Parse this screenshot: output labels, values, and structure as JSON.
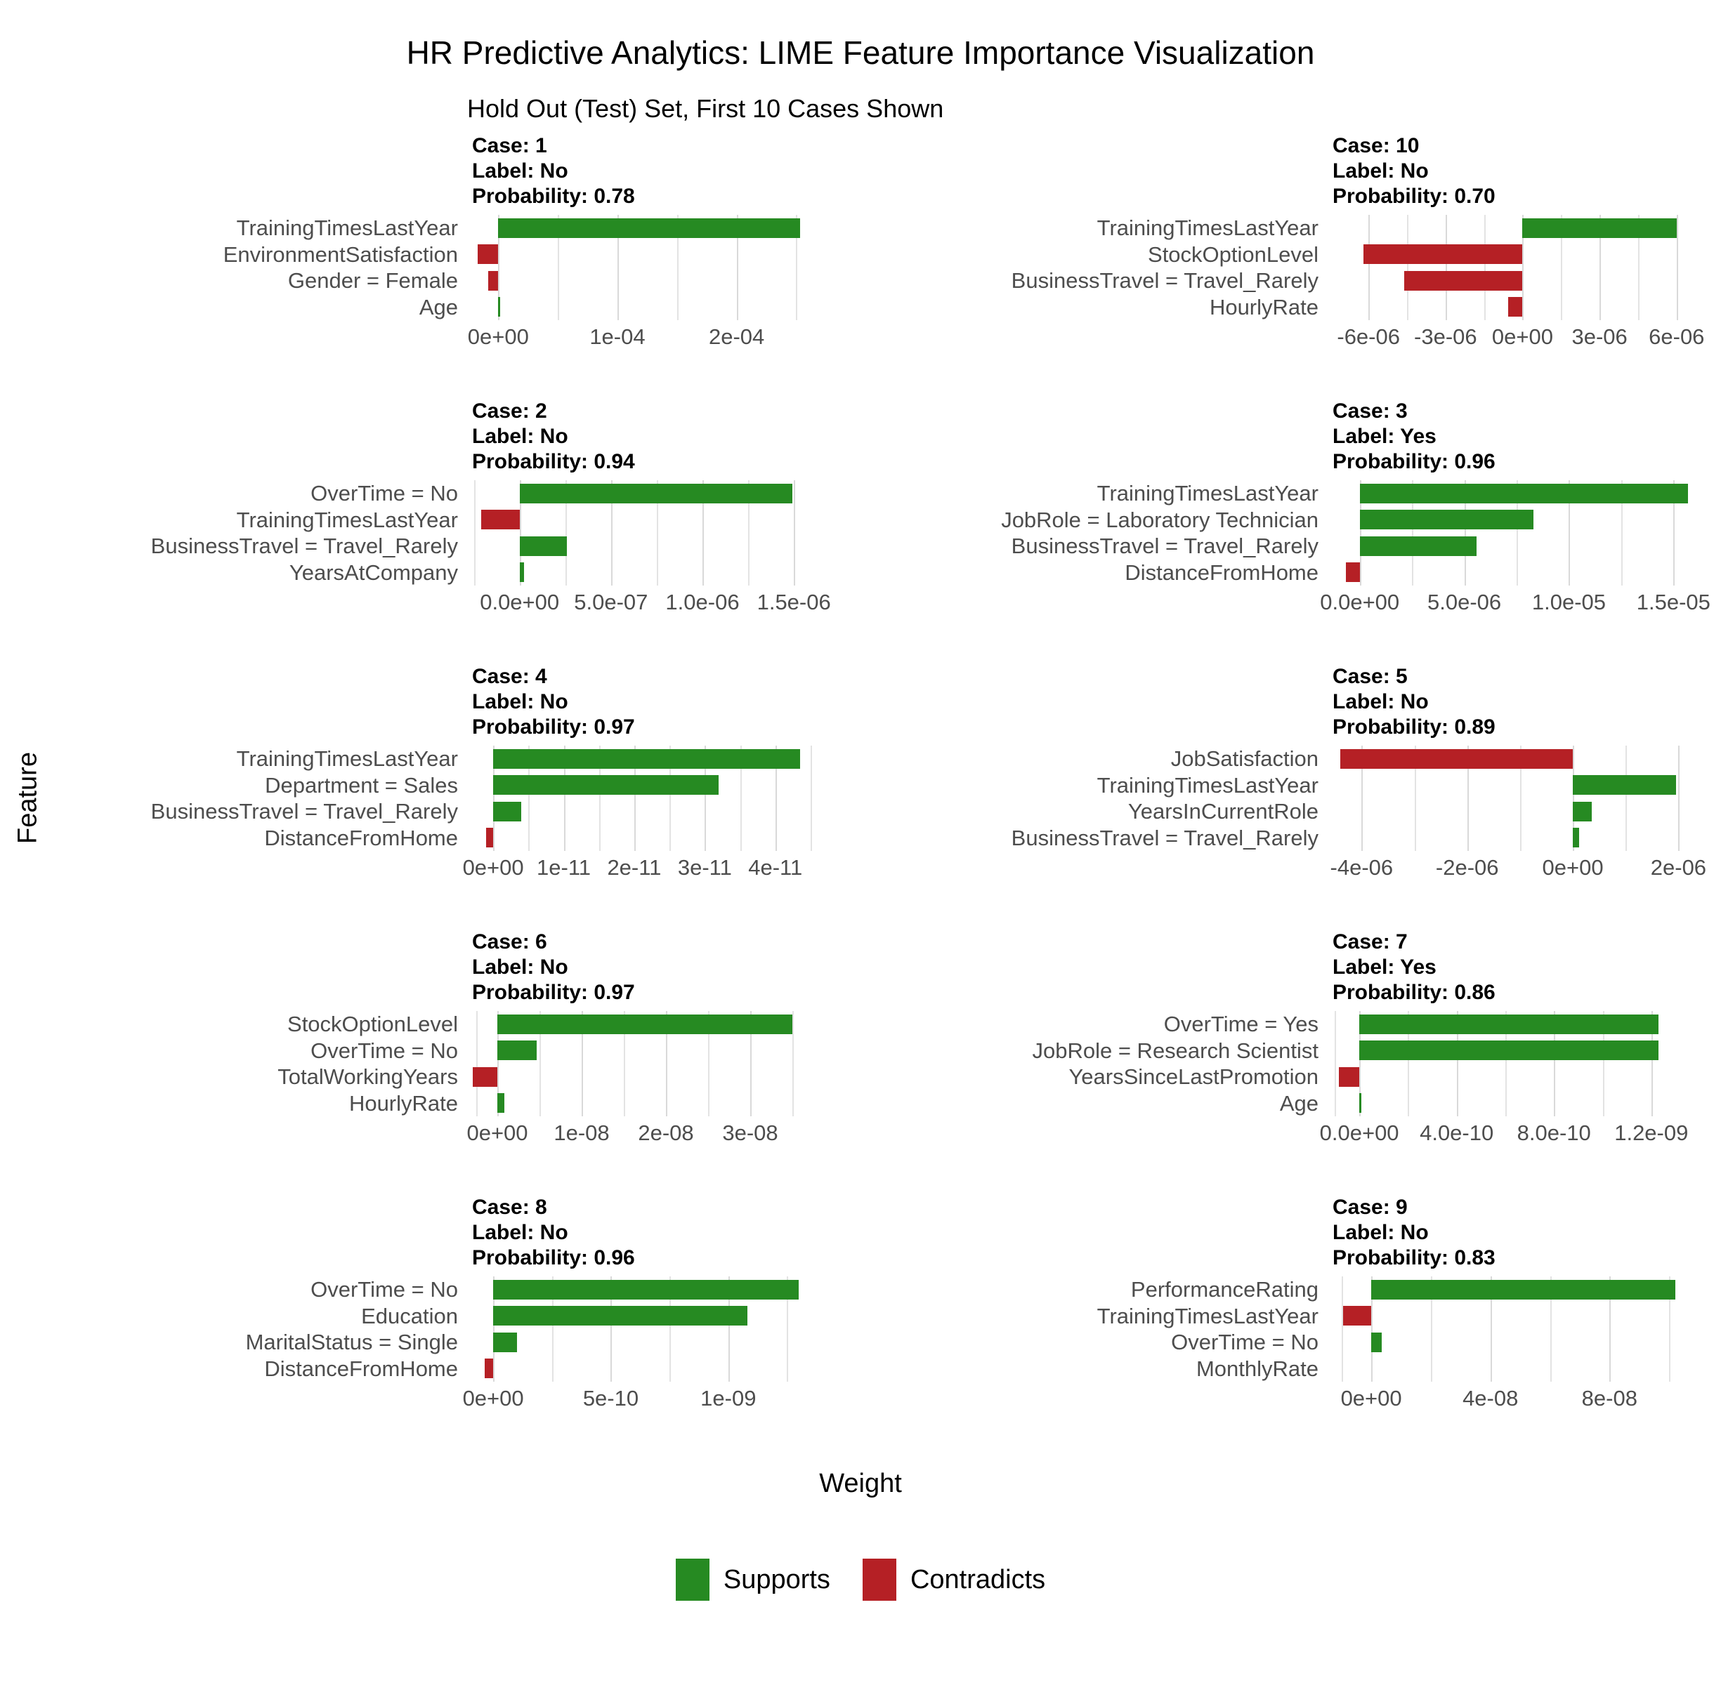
{
  "header": {
    "title": "HR Predictive Analytics: LIME Feature Importance Visualization",
    "subtitle": "Hold Out (Test) Set, First 10 Cases Shown"
  },
  "axes": {
    "y_title": "Feature",
    "x_title": "Weight"
  },
  "legend": {
    "items": [
      {
        "label": "Supports",
        "color": "#268a22",
        "key": "supports"
      },
      {
        "label": "Contradicts",
        "color": "#b52025",
        "key": "contradicts"
      }
    ]
  },
  "labels": {
    "case_prefix": "Case: ",
    "label_prefix": "Label: ",
    "probability_prefix": "Probability: "
  },
  "chart_data": {
    "type": "bar",
    "title": "HR Predictive Analytics: LIME Feature Importance Visualization",
    "subtitle": "Hold Out (Test) Set, First 10 Cases Shown",
    "xlabel": "Weight",
    "ylabel": "Feature",
    "orientation": "horizontal",
    "grid": true,
    "legend_position": "bottom",
    "series_colors": {
      "supports": "#268a22",
      "contradicts": "#b52025"
    },
    "panels": [
      {
        "case": "1",
        "label": "No",
        "probability": "0.78",
        "head_lines": [
          "Case: 1",
          "Label: No",
          "Probability: 0.78"
        ],
        "xlim": [
          -2.2e-05,
          0.000268
        ],
        "xticks": [
          0,
          0.0001,
          0.0002
        ],
        "xtick_labels": [
          "0e+00",
          "1e-04",
          "2e-04"
        ],
        "gridlines": [
          -5e-05,
          0,
          5e-05,
          0.0001,
          0.00015,
          0.0002,
          0.00025
        ],
        "features": [
          "TrainingTimesLastYear",
          "EnvironmentSatisfaction",
          "Gender = Female",
          "Age"
        ],
        "values": [
          0.000253,
          -1.75e-05,
          -8.2e-06,
          1.3e-06
        ],
        "signs": [
          "supports",
          "contradicts",
          "contradicts",
          "supports"
        ]
      },
      {
        "case": "10",
        "label": "No",
        "probability": "0.70",
        "head_lines": [
          "Case: 10",
          "Label: No",
          "Probability: 0.70"
        ],
        "xlim": [
          -7.4e-06,
          7.1e-06
        ],
        "xticks": [
          -6e-06,
          -3e-06,
          0,
          3e-06,
          6e-06
        ],
        "xtick_labels": [
          "-6e-06",
          "-3e-06",
          "0e+00",
          "3e-06",
          "6e-06"
        ],
        "gridlines": [
          -6e-06,
          -4.5e-06,
          -3e-06,
          -1.5e-06,
          0,
          1.5e-06,
          3e-06,
          4.5e-06,
          6e-06
        ],
        "features": [
          "TrainingTimesLastYear",
          "StockOptionLevel",
          "BusinessTravel = Travel_Rarely",
          "HourlyRate"
        ],
        "values": [
          6e-06,
          -6.2e-06,
          -4.6e-06,
          -5.5e-07
        ],
        "signs": [
          "supports",
          "contradicts",
          "contradicts",
          "contradicts"
        ]
      },
      {
        "case": "2",
        "label": "No",
        "probability": "0.94",
        "head_lines": [
          "Case: 2",
          "Label: No",
          "Probability: 0.94"
        ],
        "xlim": [
          -2.6e-07,
          1.63e-06
        ],
        "xticks": [
          0,
          5e-07,
          1e-06,
          1.5e-06
        ],
        "xtick_labels": [
          "0.0e+00",
          "5.0e-07",
          "1.0e-06",
          "1.5e-06"
        ],
        "gridlines": [
          -2.5e-07,
          0,
          2.5e-07,
          5e-07,
          7.5e-07,
          1e-06,
          1.25e-06,
          1.5e-06
        ],
        "features": [
          "OverTime = No",
          "TrainingTimesLastYear",
          "BusinessTravel = Travel_Rarely",
          "YearsAtCompany"
        ],
        "values": [
          1.49e-06,
          -2.1e-07,
          2.6e-07,
          2.5e-08
        ],
        "signs": [
          "supports",
          "contradicts",
          "supports",
          "supports"
        ]
      },
      {
        "case": "3",
        "label": "Yes",
        "probability": "0.96",
        "head_lines": [
          "Case: 3",
          "Label: Yes",
          "Probability: 0.96"
        ],
        "xlim": [
          -1.3e-06,
          1.65e-05
        ],
        "xticks": [
          0,
          5e-06,
          1e-05,
          1.5e-05
        ],
        "xtick_labels": [
          "0.0e+00",
          "5.0e-06",
          "1.0e-05",
          "1.5e-05"
        ],
        "gridlines": [
          0,
          2.5e-06,
          5e-06,
          7.5e-06,
          1e-05,
          1.25e-05,
          1.5e-05
        ],
        "features": [
          "TrainingTimesLastYear",
          "JobRole = Laboratory Technician",
          "BusinessTravel = Travel_Rarely",
          "DistanceFromHome"
        ],
        "values": [
          1.57e-05,
          8.3e-06,
          5.6e-06,
          -6.5e-07
        ],
        "signs": [
          "supports",
          "supports",
          "supports",
          "contradicts"
        ]
      },
      {
        "case": "4",
        "label": "No",
        "probability": "0.97",
        "head_lines": [
          "Case: 4",
          "Label: No",
          "Probability: 0.97"
        ],
        "xlim": [
          -3e-12,
          4.6e-11
        ],
        "xticks": [
          0,
          1e-11,
          2e-11,
          3e-11,
          4e-11
        ],
        "xtick_labels": [
          "0e+00",
          "1e-11",
          "2e-11",
          "3e-11",
          "4e-11"
        ],
        "gridlines": [
          0,
          5e-12,
          1e-11,
          1.5e-11,
          2e-11,
          2.5e-11,
          3e-11,
          3.5e-11,
          4e-11,
          4.5e-11
        ],
        "features": [
          "TrainingTimesLastYear",
          "Department = Sales",
          "BusinessTravel = Travel_Rarely",
          "DistanceFromHome"
        ],
        "values": [
          4.35e-11,
          3.2e-11,
          4e-12,
          -1e-12
        ],
        "signs": [
          "supports",
          "supports",
          "supports",
          "contradicts"
        ]
      },
      {
        "case": "5",
        "label": "No",
        "probability": "0.89",
        "head_lines": [
          "Case: 5",
          "Label: No",
          "Probability: 0.89"
        ],
        "xlim": [
          -4.55e-06,
          2.5e-06
        ],
        "xticks": [
          -4e-06,
          -2e-06,
          0,
          2e-06
        ],
        "xtick_labels": [
          "-4e-06",
          "-2e-06",
          "0e+00",
          "2e-06"
        ],
        "gridlines": [
          -4e-06,
          -3e-06,
          -2e-06,
          -1e-06,
          0,
          1e-06,
          2e-06
        ],
        "features": [
          "JobSatisfaction",
          "TrainingTimesLastYear",
          "YearsInCurrentRole",
          "BusinessTravel = Travel_Rarely"
        ],
        "values": [
          -4.4e-06,
          1.95e-06,
          3.6e-07,
          1.2e-07
        ],
        "signs": [
          "contradicts",
          "supports",
          "supports",
          "supports"
        ]
      },
      {
        "case": "6",
        "label": "No",
        "probability": "0.97",
        "head_lines": [
          "Case: 6",
          "Label: No",
          "Probability: 0.97"
        ],
        "xlim": [
          -3e-09,
          3.8e-08
        ],
        "xticks": [
          0,
          1e-08,
          2e-08,
          3e-08
        ],
        "xtick_labels": [
          "0e+00",
          "1e-08",
          "2e-08",
          "3e-08"
        ],
        "gridlines": [
          -2.5e-09,
          0,
          5e-09,
          1e-08,
          1.5e-08,
          2e-08,
          2.5e-08,
          3e-08,
          3.5e-08
        ],
        "features": [
          "StockOptionLevel",
          "OverTime = No",
          "TotalWorkingYears",
          "HourlyRate"
        ],
        "values": [
          3.5e-08,
          4.7e-09,
          -2.9e-09,
          8e-10
        ],
        "signs": [
          "supports",
          "supports",
          "contradicts",
          "supports"
        ]
      },
      {
        "case": "7",
        "label": "Yes",
        "probability": "0.86",
        "head_lines": [
          "Case: 7",
          "Label: Yes",
          "Probability: 0.86"
        ],
        "xlim": [
          -1.1e-10,
          1.42e-09
        ],
        "xticks": [
          0,
          4e-10,
          8e-10,
          1.2e-09
        ],
        "xtick_labels": [
          "0.0e+00",
          "4.0e-10",
          "8.0e-10",
          "1.2e-09"
        ],
        "gridlines": [
          -1e-10,
          0,
          2e-10,
          4e-10,
          6e-10,
          8e-10,
          1e-09,
          1.2e-09
        ],
        "features": [
          "OverTime = Yes",
          "JobRole = Research Scientist",
          "YearsSinceLastPromotion",
          "Age"
        ],
        "values": [
          1.23e-09,
          1.23e-09,
          -8.5e-11,
          6e-12
        ],
        "signs": [
          "supports",
          "supports",
          "contradicts",
          "supports"
        ]
      },
      {
        "case": "8",
        "label": "No",
        "probability": "0.96",
        "head_lines": [
          "Case: 8",
          "Label: No",
          "Probability: 0.96"
        ],
        "xlim": [
          -9e-11,
          1.38e-09
        ],
        "xticks": [
          0,
          5e-10,
          1e-09
        ],
        "xtick_labels": [
          "0e+00",
          "5e-10",
          "1e-09"
        ],
        "gridlines": [
          0,
          2.5e-10,
          5e-10,
          7.5e-10,
          1e-09,
          1.25e-09
        ],
        "features": [
          "OverTime = No",
          "Education",
          "MaritalStatus = Single",
          "DistanceFromHome"
        ],
        "values": [
          1.3e-09,
          1.08e-09,
          1e-10,
          -3.5e-11
        ],
        "signs": [
          "supports",
          "supports",
          "supports",
          "contradicts"
        ]
      },
      {
        "case": "9",
        "label": "No",
        "probability": "0.83",
        "head_lines": [
          "Case: 9",
          "Label: No",
          "Probability: 0.83"
        ],
        "xlim": [
          -1.3e-08,
          1.12e-07
        ],
        "xticks": [
          0,
          4e-08,
          8e-08
        ],
        "xtick_labels": [
          "0e+00",
          "4e-08",
          "8e-08"
        ],
        "gridlines": [
          -1e-08,
          0,
          2e-08,
          4e-08,
          6e-08,
          8e-08,
          1e-07
        ],
        "features": [
          "PerformanceRating",
          "TrainingTimesLastYear",
          "OverTime = No",
          "MonthlyRate"
        ],
        "values": [
          1.02e-07,
          -9.5e-09,
          3.5e-09,
          0
        ],
        "signs": [
          "supports",
          "contradicts",
          "supports",
          "supports"
        ]
      }
    ]
  }
}
